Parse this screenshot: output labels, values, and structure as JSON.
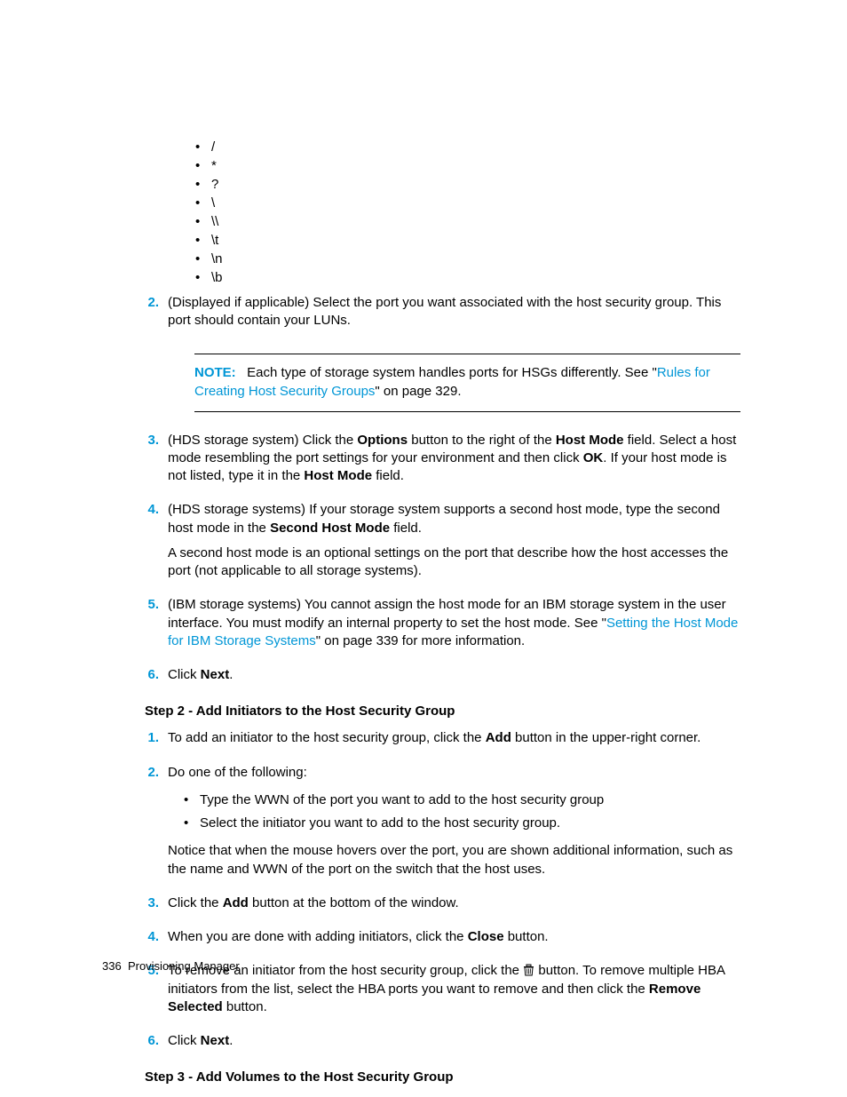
{
  "chars": [
    "/",
    "*",
    "?",
    "\\",
    "\\\\",
    "\\t",
    "\\n",
    "\\b"
  ],
  "items": [
    {
      "n": "2.",
      "html": "(Displayed if applicable) Select the port you want associated with the host security group. This port should contain your LUNs."
    },
    {
      "note": true,
      "label": "NOTE:",
      "pre": "Each type of storage system handles ports for HSGs differently. See \"",
      "link": "Rules for Creating Host Security Groups",
      "post": "\" on page 329."
    },
    {
      "n": "3.",
      "html": "(HDS storage system) Click the <b>Options</b> button to the right of the <b>Host Mode</b> field. Select a host mode resembling the port settings for your environment and then click <b>OK</b>. If your host mode is not listed, type it in the <b>Host Mode</b> field."
    },
    {
      "n": "4.",
      "html": "(HDS storage systems) If your storage system supports a second host mode, type the second host mode in the <b>Second Host Mode</b> field.",
      "para2": "A second host mode is an optional settings on the port that describe how the host accesses the port (not applicable to all storage systems)."
    },
    {
      "n": "5.",
      "pre": "(IBM storage systems) You cannot assign the host mode for an IBM storage system in the user interface. You must modify an internal property to set the host mode. See \"",
      "link": "Setting the Host Mode for IBM Storage Systems",
      "post": "\" on page 339 for more information."
    },
    {
      "n": "6.",
      "html": "Click <b>Next</b>."
    }
  ],
  "step2": {
    "heading": "Step 2 - Add Initiators to the Host Security Group",
    "items": [
      {
        "n": "1.",
        "html": "To add an initiator to the host security group, click the <b>Add</b> button in the upper-right corner."
      },
      {
        "n": "2.",
        "html": "Do one of the following:",
        "sub": [
          "Type the WWN of the port you want to add to the host security group",
          "Select the initiator you want to add to the host security group."
        ],
        "para2": "Notice that when the mouse hovers over the port, you are shown additional information, such as the name and WWN of the port on the switch that the host uses."
      },
      {
        "n": "3.",
        "html": "Click the <b>Add</b> button at the bottom of the window."
      },
      {
        "n": "4.",
        "html": "When you are done with adding initiators, click the <b>Close</b> button."
      },
      {
        "n": "5.",
        "pre": "To remove an initiator from the host security group, click the ",
        "icon": true,
        "post": " button. To remove multiple HBA initiators from the list, select the HBA ports you want to remove and then click the <b>Remove Selected</b> button."
      },
      {
        "n": "6.",
        "html": "Click <b>Next</b>."
      }
    ]
  },
  "step3": {
    "heading": "Step 3 - Add Volumes to the Host Security Group"
  },
  "footer": {
    "page": "336",
    "section": "Provisioning Manager"
  }
}
